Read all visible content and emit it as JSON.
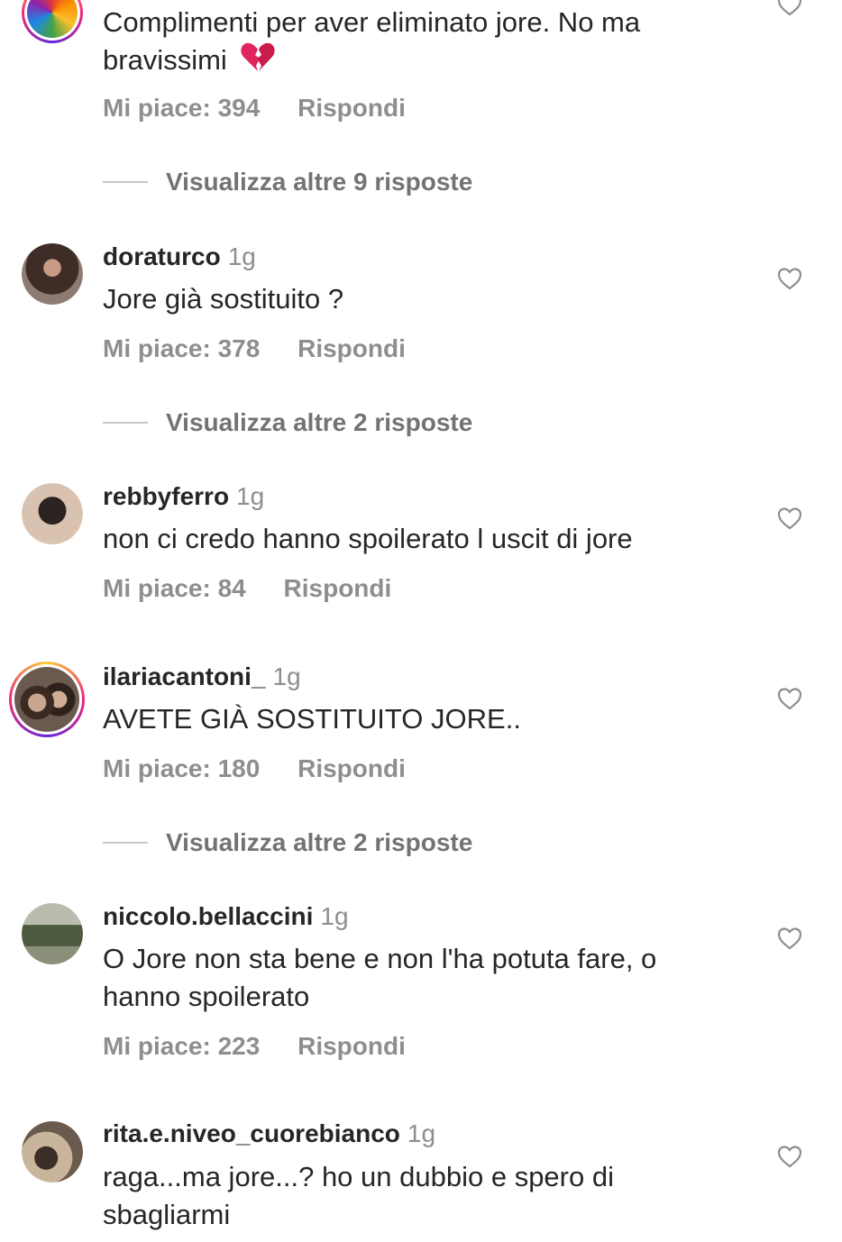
{
  "comments": [
    {
      "username": "",
      "time": "",
      "text": "Complimenti per aver eliminato jore. No ma bravissimi",
      "emoji_icon": "broken-heart-icon",
      "likes": "Mi piace: 394",
      "reply": "Rispondi",
      "more": "Visualizza altre 9 risposte",
      "avatar_colors": [
        "#e53935",
        "#fbc02d",
        "#43a047",
        "#1e88e5",
        "#8e24aa"
      ]
    },
    {
      "username": "doraturco",
      "time": "1g",
      "text": "Jore già sostituito ?",
      "likes": "Mi piace: 378",
      "reply": "Rispondi",
      "more": "Visualizza altre 2 risposte",
      "avatar_colors": [
        "#3e2c27",
        "#a67b6a"
      ]
    },
    {
      "username": "rebbyferro",
      "time": "1g",
      "text": "non ci credo hanno spoilerato l uscit di jore",
      "likes": "Mi piace: 84",
      "reply": "Rispondi",
      "avatar_colors": [
        "#2b2320",
        "#d9c3b0"
      ]
    },
    {
      "username": "ilariacantoni_",
      "time": "1g",
      "text": "AVETE GIÀ SOSTITUITO JORE..",
      "likes": "Mi piace: 180",
      "reply": "Rispondi",
      "more": "Visualizza altre 2 risposte",
      "avatar_colors": [
        "#3a2a22",
        "#c7a58e"
      ]
    },
    {
      "username": "niccolo.bellaccini",
      "time": "1g",
      "text": "O Jore non sta bene e non l'ha potuta fare, o hanno spoilerato",
      "likes": "Mi piace: 223",
      "reply": "Rispondi",
      "avatar_colors": [
        "#4d5a3d",
        "#8a8f7a"
      ]
    },
    {
      "username": "rita.e.niveo_cuorebianco",
      "time": "1g",
      "text": "raga...ma jore...? ho un dubbio e spero di sbagliarmi",
      "avatar_colors": [
        "#6b5a4e",
        "#c9b59b"
      ]
    }
  ]
}
